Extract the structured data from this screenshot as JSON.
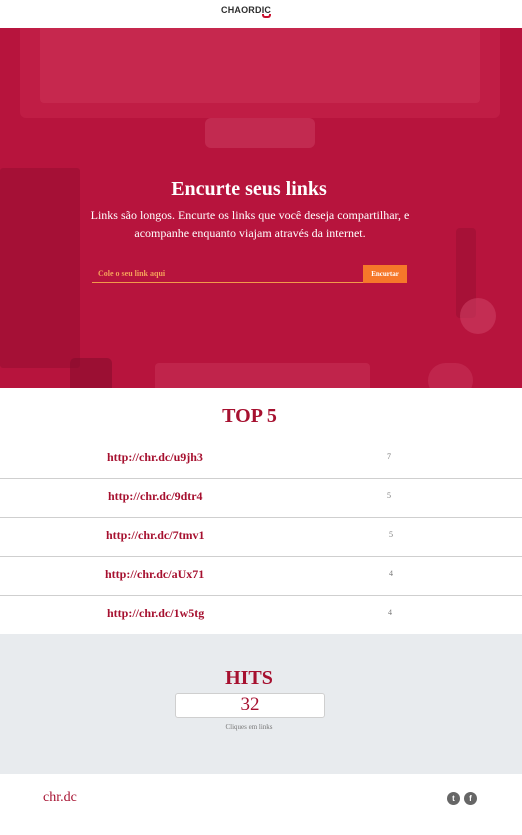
{
  "header": {
    "logo_text": "CHAORDIC"
  },
  "hero": {
    "title": "Encurte seus links",
    "subtitle": "Links são longos. Encurte os links que você deseja compartilhar, e acompanhe enquanto viajam através da internet.",
    "input_placeholder": "Cole o seu link aqui",
    "input_value": "",
    "shorten_label": "Encurtar"
  },
  "top5": {
    "title": "TOP 5",
    "items": [
      {
        "url": "http://chr.dc/u9jh3",
        "count": "7"
      },
      {
        "url": "http://chr.dc/9dtr4",
        "count": "5"
      },
      {
        "url": "http://chr.dc/7tmv1",
        "count": "5"
      },
      {
        "url": "http://chr.dc/aUx71",
        "count": "4"
      },
      {
        "url": "http://chr.dc/1w5tg",
        "count": "4"
      }
    ]
  },
  "hits": {
    "title": "HITS",
    "value": "32",
    "label": "Cliques em links"
  },
  "footer": {
    "brand": "chr.dc",
    "social_icons": [
      "twitter-icon",
      "facebook-icon"
    ]
  },
  "colors": {
    "brand_red": "#a6102f",
    "hero_red": "#b8173f",
    "accent_orange": "#f6782a",
    "hits_bg": "#e8ebee"
  }
}
